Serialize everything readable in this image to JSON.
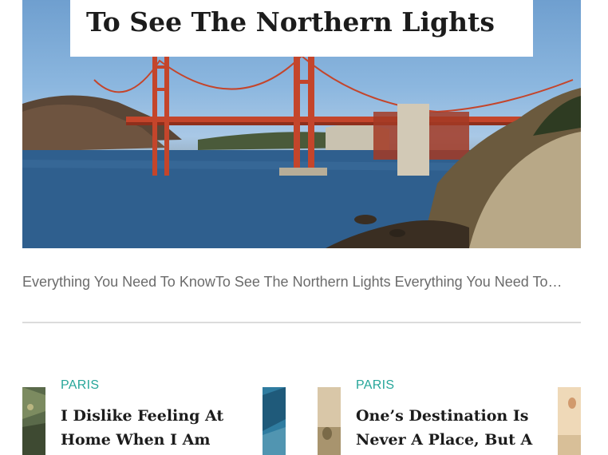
{
  "featured": {
    "title": "To See The Northern Lights",
    "excerpt": "Everything You Need To KnowTo See The Northern Lights Everything You Need To…",
    "image": "golden-gate-bridge-photo"
  },
  "posts": [
    {
      "category": "PARIS",
      "title": "I Dislike Feeling At Home When I Am"
    },
    {
      "category": "PARIS",
      "title": "One’s Destination Is Never A Place, But A"
    }
  ],
  "colors": {
    "accent": "#27a69a",
    "title": "#1c1c1c",
    "excerpt": "#6b6b6b",
    "divider": "#dcdcdc"
  }
}
